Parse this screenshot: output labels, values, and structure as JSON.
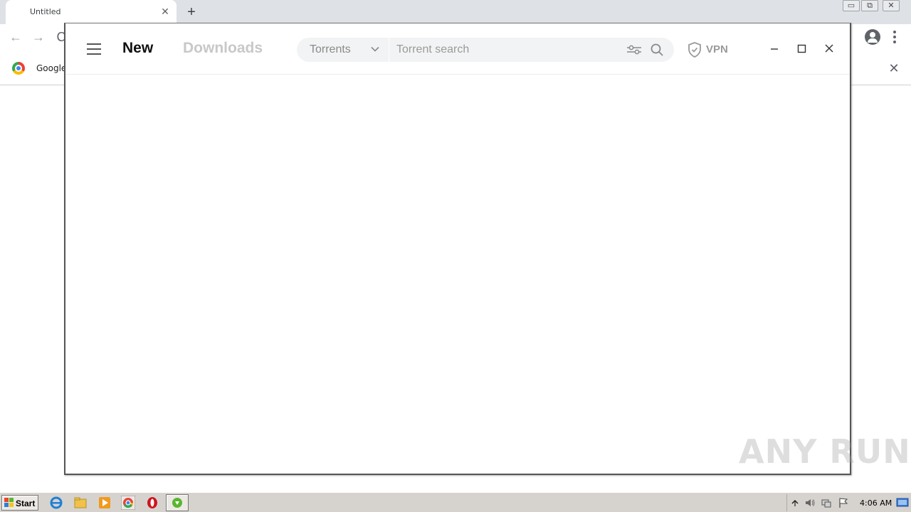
{
  "browser": {
    "tab_title": "Untitled",
    "tab_close": "✕",
    "new_tab": "+",
    "bookmark_label": "Google",
    "bookmark_close": "✕",
    "back": "←",
    "forward": "→",
    "reload": "C",
    "window_controls": [
      "▭",
      "⧉",
      "✕"
    ]
  },
  "app": {
    "tab_new": "New",
    "tab_downloads": "Downloads",
    "search": {
      "category": "Torrents",
      "placeholder": "Torrent search",
      "value": ""
    },
    "vpn_label": "VPN"
  },
  "watermark": "ANY RUN",
  "taskbar": {
    "start_label": "Start",
    "clock": "4:06 AM"
  },
  "colors": {
    "accent_text": "#111111",
    "muted_tab": "#c8c8c8",
    "search_bg": "#f2f3f4",
    "taskbar_bg": "#d6d3ce"
  }
}
